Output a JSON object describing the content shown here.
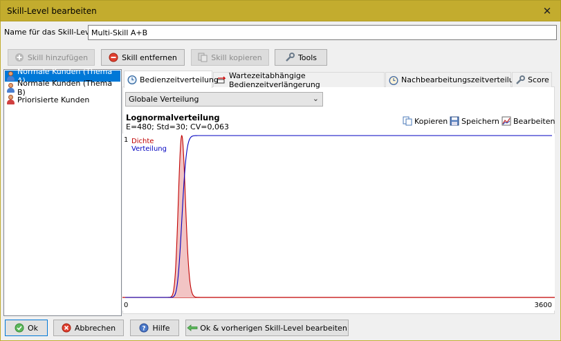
{
  "window": {
    "title": "Skill-Level bearbeiten",
    "close_label": "✕"
  },
  "name_field": {
    "label": "Name für das Skill-Level",
    "value": "Multi-Skill A+B"
  },
  "toolbar": {
    "add": "Skill hinzufügen",
    "remove": "Skill entfernen",
    "copy": "Skill kopieren",
    "tools": "Tools"
  },
  "skills": [
    {
      "label": "Normale Kunden (Thema A)",
      "selected": true
    },
    {
      "label": "Normale Kunden (Thema B)",
      "selected": false
    },
    {
      "label": "Priorisierte Kunden",
      "selected": false
    }
  ],
  "tabs": [
    {
      "label": "Bedienzeitverteilung",
      "active": true
    },
    {
      "label": "Wartezeitabhängige Bedienzeitverlängerung",
      "active": false
    },
    {
      "label": "Nachbearbeitungszeitverteilung",
      "active": false
    },
    {
      "label": "Score",
      "active": false
    }
  ],
  "distribution": {
    "mode_select": "Globale Verteilung",
    "name": "Lognormalverteilung",
    "stats": "E=480; Std=30; CV=0,063",
    "actions": {
      "copy": "Kopieren",
      "save": "Speichern",
      "edit": "Bearbeiten"
    }
  },
  "chart_data": {
    "type": "line",
    "series": [
      {
        "name": "Dichte",
        "color": "#c00000"
      },
      {
        "name": "Verteilung",
        "color": "#0000c0"
      }
    ],
    "lognormal": {
      "mean": 480,
      "std": 30
    },
    "xlim": [
      0,
      3600
    ],
    "x_tick_labels": [
      "0",
      "3600"
    ],
    "y_tick_label": "1"
  },
  "footer": {
    "ok": "Ok",
    "cancel": "Abbrechen",
    "help": "Hilfe",
    "ok_prev": "Ok & vorherigen Skill-Level bearbeiten"
  }
}
